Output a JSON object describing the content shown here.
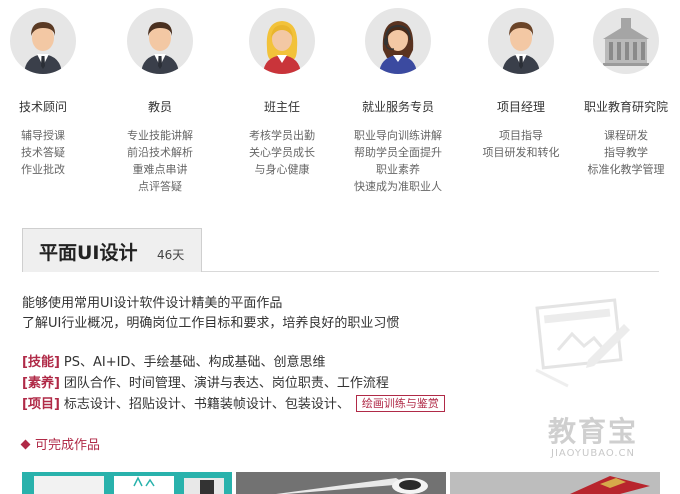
{
  "roles": [
    {
      "title": "技术顾问",
      "duties": [
        "辅导授课",
        "技术答疑",
        "作业批改"
      ],
      "avatar": "male-tie-avatar-icon"
    },
    {
      "title": "教员",
      "duties": [
        "专业技能讲解",
        "前沿技术解析",
        "重难点串讲",
        "点评答疑"
      ],
      "avatar": "male-tie-avatar-icon"
    },
    {
      "title": "班主任",
      "duties": [
        "考核学员出勤",
        "关心学员成长",
        "与身心健康"
      ],
      "avatar": "female-blonde-avatar-icon"
    },
    {
      "title": "就业服务专员",
      "duties": [
        "职业导向训练讲解",
        "帮助学员全面提升",
        "职业素养",
        "快速成为准职业人"
      ],
      "avatar": "female-headset-avatar-icon"
    },
    {
      "title": "项目经理",
      "duties": [
        "项目指导",
        "项目研发和转化"
      ],
      "avatar": "male-tie-avatar-icon"
    },
    {
      "title": "职业教育研究院",
      "duties": [
        "课程研发",
        "指导教学",
        "标准化教学管理"
      ],
      "avatar": "building-icon"
    }
  ],
  "course": {
    "name": "平面UI设计",
    "days": "46天"
  },
  "intro": [
    "能够使用常用UI设计软件设计精美的平面作品",
    "了解UI行业概况，明确岗位工作目标和要求，培养良好的职业习惯"
  ],
  "skills": [
    {
      "tag": "[技能]",
      "text": "PS、AI+ID、手绘基础、构成基础、创意思维"
    },
    {
      "tag": "[素养]",
      "text": "团队合作、时间管理、演讲与表达、岗位职责、工作流程"
    },
    {
      "tag": "[项目]",
      "text": "标志设计、招贴设计、书籍装帧设计、包装设计、",
      "highlight": "绘画训练与鉴赏"
    }
  ],
  "works_title": "可完成作品",
  "watermark": {
    "main": "教育宝",
    "sub": "JIAOYUBAO.CN"
  },
  "colors": {
    "accent": "#b02a47",
    "avatar_bg": "#e6e6e6",
    "tab_bg": "#efefef"
  }
}
